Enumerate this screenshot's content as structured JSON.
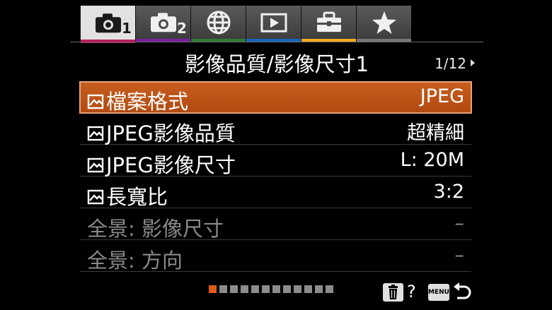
{
  "tabs": [
    {
      "name": "camera-1",
      "icon": "camera-icon",
      "sub": "1",
      "color": "#c2185b",
      "active": true
    },
    {
      "name": "camera-2",
      "icon": "camera-icon",
      "sub": "2",
      "color": "#7b1fa2",
      "active": false
    },
    {
      "name": "network",
      "icon": "globe-icon",
      "sub": "",
      "color": "#2e7d32",
      "active": false
    },
    {
      "name": "playback",
      "icon": "play-icon",
      "sub": "",
      "color": "#1565c0",
      "active": false
    },
    {
      "name": "setup",
      "icon": "toolbox-icon",
      "sub": "",
      "color": "#f9a825",
      "active": false
    },
    {
      "name": "my-menu",
      "icon": "star-icon",
      "sub": "",
      "color": "#777777",
      "active": false
    }
  ],
  "header": {
    "title": "影像品質/影像尺寸1",
    "page": "1/12"
  },
  "rows": [
    {
      "label": "檔案格式",
      "value": "JPEG",
      "icon": true,
      "selected": true,
      "dim": false
    },
    {
      "label": "JPEG影像品質",
      "value": "超精細",
      "icon": true,
      "selected": false,
      "dim": false
    },
    {
      "label": "JPEG影像尺寸",
      "value": "L: 20M",
      "icon": true,
      "selected": false,
      "dim": false
    },
    {
      "label": "長寬比",
      "value": "3:2",
      "icon": true,
      "selected": false,
      "dim": false
    },
    {
      "label": "全景: 影像尺寸",
      "value": "–",
      "icon": false,
      "selected": false,
      "dim": true
    },
    {
      "label": "全景: 方向",
      "value": "–",
      "icon": false,
      "selected": false,
      "dim": true
    }
  ],
  "footer": {
    "page_count": 12,
    "current_page": 1,
    "help_label": "?",
    "menu_label": "MENU"
  },
  "colors": {
    "selection": "#c75e1f",
    "pager_active": "#e25a1a"
  }
}
